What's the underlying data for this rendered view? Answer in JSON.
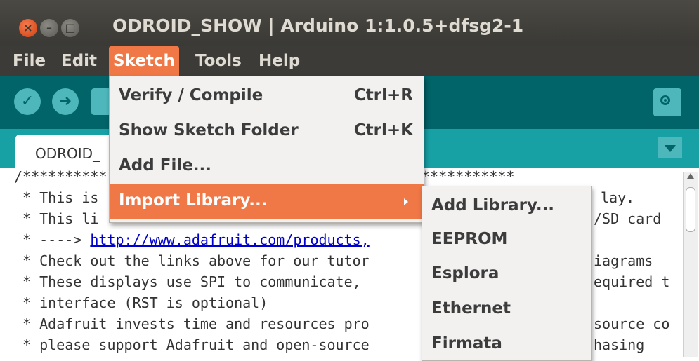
{
  "window": {
    "title": "ODROID_SHOW | Arduino 1:1.0.5+dfsg2-1",
    "close_glyph": "×",
    "min_glyph": "–",
    "max_glyph": "□"
  },
  "menubar": {
    "file": "File",
    "edit": "Edit",
    "sketch": "Sketch",
    "tools": "Tools",
    "help": "Help"
  },
  "toolbar": {
    "verify_icon": "check-icon",
    "upload_icon": "arrow-right-icon",
    "serial_monitor_icon": "magnifier-icon"
  },
  "tabs": {
    "active_label": "ODROID_"
  },
  "editor": {
    "lines": [
      "/**********",
      " * This is",
      " * This li",
      " * ---->",
      " * Check out the links above for our tutor",
      " * These displays use SPI to communicate,",
      " * interface (RST is optional)",
      " * Adafruit invests time and resources pro",
      " * please support Adafruit and open-source"
    ],
    "link": "http://www.adafruit.com/products,",
    "line0_right": "***********",
    "right_fragments": [
      "lay.",
      "/SD card",
      "",
      "iagrams",
      "equired t",
      "",
      "source co",
      "hasing"
    ]
  },
  "sketch_menu": {
    "items": [
      {
        "label": "Verify / Compile",
        "shortcut": "Ctrl+R"
      },
      {
        "label": "Show Sketch Folder",
        "shortcut": "Ctrl+K"
      },
      {
        "label": "Add File...",
        "shortcut": ""
      },
      {
        "label": "Import Library...",
        "shortcut": "›"
      }
    ]
  },
  "import_submenu": {
    "items": [
      "Add Library...",
      "EEPROM",
      "Esplora",
      "Ethernet",
      "Firmata"
    ]
  },
  "colors": {
    "accent": "#f07746",
    "toolbar": "#006468",
    "tabstrip": "#17a1a5",
    "titlebar": "#3c3b37"
  }
}
